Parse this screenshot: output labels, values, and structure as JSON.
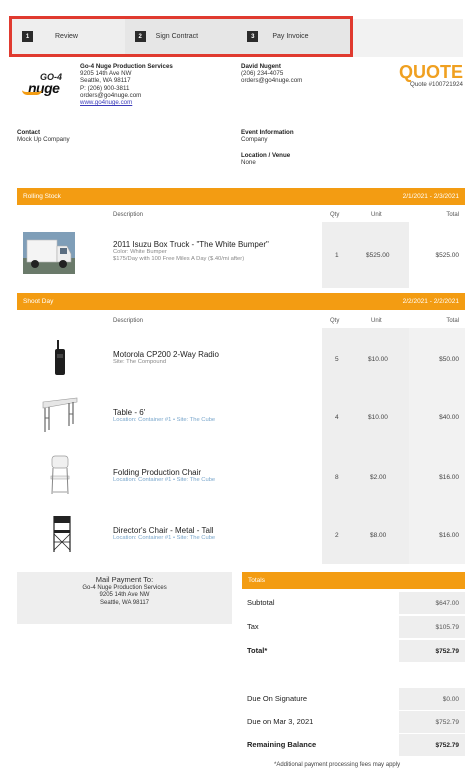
{
  "steps": [
    {
      "num": "1",
      "label": "Review"
    },
    {
      "num": "2",
      "label": "Sign Contract"
    },
    {
      "num": "3",
      "label": "Pay Invoice"
    }
  ],
  "logo": {
    "line1": "GO-4",
    "line2": "nuge",
    "accent": "#f39c12"
  },
  "vendor": {
    "name": "Go-4 Nuge Production Services",
    "address1": "9205 14th Ave NW",
    "address2": "Seattle, WA 98117",
    "phone": "P: (206) 900-3811",
    "email": "orders@go4nuge.com",
    "website": "www.go4nuge.com"
  },
  "client": {
    "name": "David Nugent",
    "phone": "(206) 234-4075",
    "email": "orders@go4nuge.com"
  },
  "quote": {
    "title": "QUOTE",
    "number": "Quote #100721924",
    "accent": "#f0a020"
  },
  "contact": {
    "label": "Contact",
    "value": "Mock Up Company"
  },
  "event_info": {
    "label": "Event Information",
    "value": "Company"
  },
  "location": {
    "label": "Location / Venue",
    "value": "None"
  },
  "columns": {
    "description": "Description",
    "qty": "Qty",
    "unit": "Unit",
    "total": "Total"
  },
  "sections": [
    {
      "name": "Rolling Stock",
      "dates": "2/1/2021 - 2/3/2021",
      "items": [
        {
          "title": "2011 Isuzu Box Truck - \"The White Bumper\"",
          "sub1": "Color: White Bumper",
          "sub2": "$175/Day with 100 Free Miles A Day ($.40/mi after)",
          "qty": "1",
          "unit": "$525.00",
          "total": "$525.00",
          "icon": "box-truck-image"
        }
      ]
    },
    {
      "name": "Shoot Day",
      "dates": "2/2/2021 - 2/2/2021",
      "items": [
        {
          "title": "Motorola CP200 2-Way Radio",
          "sub1": "Site: The Compound",
          "qty": "5",
          "unit": "$10.00",
          "total": "$50.00",
          "icon": "radio-image"
        },
        {
          "title": "Table - 6'",
          "sub1": "Location: Container #1  •  Site: The Cube",
          "qty": "4",
          "unit": "$10.00",
          "total": "$40.00",
          "icon": "table-image"
        },
        {
          "title": "Folding Production Chair",
          "sub1": "Location: Container #1  •  Site: The Cube",
          "qty": "8",
          "unit": "$2.00",
          "total": "$16.00",
          "icon": "folding-chair-image"
        },
        {
          "title": "Director's Chair - Metal - Tall",
          "sub1": "Location: Container #1  •  Site: The Cube",
          "qty": "2",
          "unit": "$8.00",
          "total": "$16.00",
          "icon": "directors-chair-image"
        }
      ]
    }
  ],
  "mail": {
    "title": "Mail Payment To:",
    "line1": "Go-4 Nuge Production Services",
    "line2": "9205 14th Ave NW",
    "line3": "Seattle, WA 98117"
  },
  "totals": {
    "header": "Totals",
    "subtotal_label": "Subtotal",
    "subtotal": "$647.00",
    "tax_label": "Tax",
    "tax": "$105.79",
    "total_label": "Total*",
    "total": "$752.79",
    "due_sig_label": "Due On Signature",
    "due_sig": "$0.00",
    "due_date_label": "Due on Mar 3, 2021",
    "due_date": "$752.79",
    "remaining_label": "Remaining Balance",
    "remaining": "$752.79"
  },
  "footnote": "*Additional payment processing fees may apply"
}
